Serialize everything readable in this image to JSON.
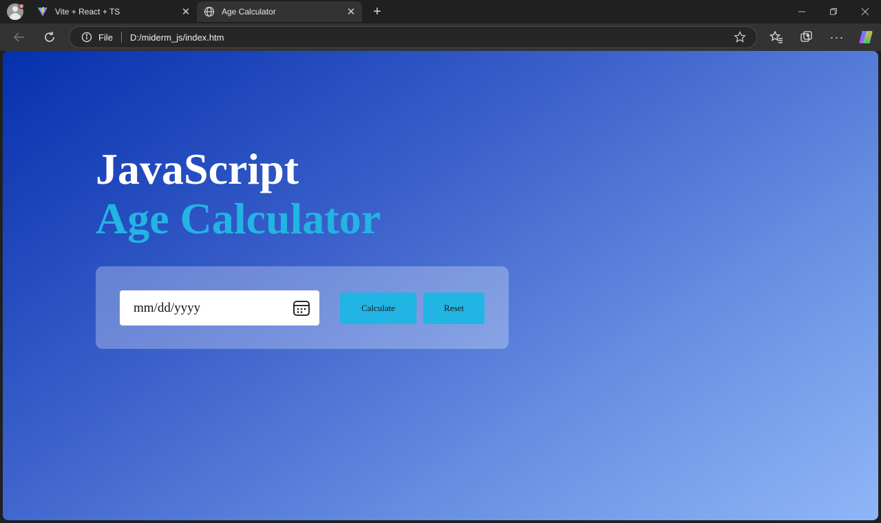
{
  "tabs": [
    {
      "title": "Vite + React + TS",
      "favicon": "vite-icon"
    },
    {
      "title": "Age Calculator",
      "favicon": "globe-icon",
      "active": true
    }
  ],
  "toolbar": {
    "scheme_label": "File",
    "url": "D:/miderm_js/index.htm"
  },
  "page": {
    "title_line1": "JavaScript",
    "title_line2": "Age Calculator",
    "date_placeholder": "mm/dd/yyyy",
    "calculate_label": "Calculate",
    "reset_label": "Reset"
  },
  "colors": {
    "accent": "#22b4e3",
    "gradient_start": "#0630ad",
    "gradient_end": "#8fb6f7"
  }
}
